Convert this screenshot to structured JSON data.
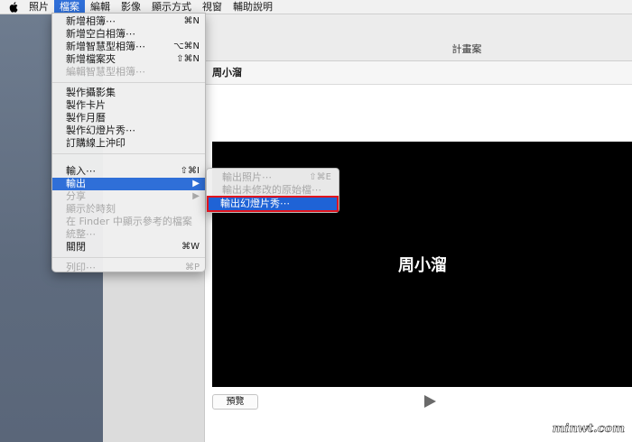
{
  "menubar": {
    "items": [
      "照片",
      "檔案",
      "編輯",
      "影像",
      "顯示方式",
      "視窗",
      "輔助說明"
    ],
    "active_index": 1
  },
  "window": {
    "title": "計畫案",
    "project_name": "周小溜",
    "slide_text": "周小溜",
    "preview_button": "預覽"
  },
  "file_menu": {
    "group1": [
      {
        "label": "新增相簿⋯",
        "shortcut": "⌘N",
        "disabled": false
      },
      {
        "label": "新增空白相簿⋯",
        "shortcut": "",
        "disabled": false
      },
      {
        "label": "新增智慧型相簿⋯",
        "shortcut": "⌥⌘N",
        "disabled": false
      },
      {
        "label": "新增檔案夾",
        "shortcut": "⇧⌘N",
        "disabled": false
      },
      {
        "label": "編輯智慧型相簿⋯",
        "shortcut": "",
        "disabled": true
      }
    ],
    "group2": [
      {
        "label": "製作攝影集",
        "shortcut": "",
        "disabled": false
      },
      {
        "label": "製作卡片",
        "shortcut": "",
        "disabled": false
      },
      {
        "label": "製作月曆",
        "shortcut": "",
        "disabled": false
      },
      {
        "label": "製作幻燈片秀⋯",
        "shortcut": "",
        "disabled": false
      },
      {
        "label": "訂購線上沖印",
        "shortcut": "",
        "disabled": false
      }
    ],
    "group3": [
      {
        "label": "輸入⋯",
        "shortcut": "⇧⌘I",
        "disabled": false
      },
      {
        "label": "輸出",
        "shortcut": "▶",
        "disabled": false,
        "highlight": true
      },
      {
        "label": "分享",
        "shortcut": "▶",
        "disabled": true
      },
      {
        "label": "顯示於時刻",
        "shortcut": "",
        "disabled": true
      },
      {
        "label": "在 Finder 中顯示參考的檔案",
        "shortcut": "",
        "disabled": true
      },
      {
        "label": "統整⋯",
        "shortcut": "",
        "disabled": true
      },
      {
        "label": "關閉",
        "shortcut": "⌘W",
        "disabled": false
      }
    ],
    "group4": [
      {
        "label": "列印⋯",
        "shortcut": "⌘P",
        "disabled": true
      }
    ]
  },
  "export_submenu": [
    {
      "label": "輸出照片⋯",
      "shortcut": "⇧⌘E",
      "disabled": true
    },
    {
      "label": "輸出未修改的原始檔⋯",
      "shortcut": "",
      "disabled": true
    },
    {
      "label": "輸出幻燈片秀⋯",
      "shortcut": "",
      "disabled": false,
      "selected": true
    }
  ],
  "colors": {
    "menu_highlight": "#2f6fd8",
    "selection_outline": "#e0141e",
    "slide_bg": "#000000"
  },
  "watermark_text": "minwt.com"
}
